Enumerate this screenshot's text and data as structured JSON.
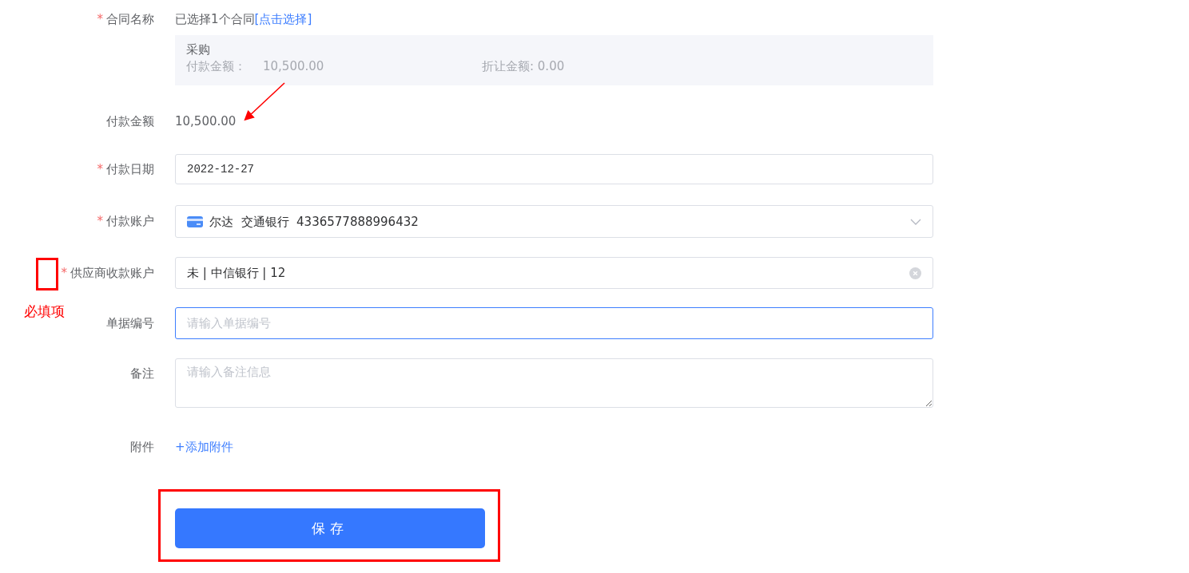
{
  "form": {
    "fields": [
      {
        "kind": "contract",
        "label": "合同名称",
        "required_mark": "*",
        "value": "已选择1个合同",
        "link": "[点击选择]",
        "summary": {
          "title": "采购",
          "amount_label": "付款金额：",
          "amount": "10,500.00",
          "discount": "折让金额: 0.00"
        }
      },
      {
        "kind": "text",
        "label": "付款金额",
        "value": "10,500.00"
      },
      {
        "kind": "date",
        "label": "付款日期",
        "required_mark": "*",
        "value": "2022-12-27"
      },
      {
        "kind": "select",
        "label": "付款账户",
        "required_mark": "*",
        "value": "尔达  交通银行  4336577888996432"
      },
      {
        "kind": "clearable",
        "label": "供应商收款账户",
        "required_mark": "*",
        "value": "未 | 中信银行 | 12"
      },
      {
        "kind": "input",
        "label": "单据编号",
        "placeholder": "请输入单据编号",
        "focused": true
      },
      {
        "kind": "textarea",
        "label": "备注",
        "placeholder": "请输入备注信息"
      },
      {
        "kind": "link",
        "label": "附件",
        "link": "+添加附件"
      }
    ],
    "save_button": "保存"
  },
  "annotation": {
    "note": "必填项"
  }
}
